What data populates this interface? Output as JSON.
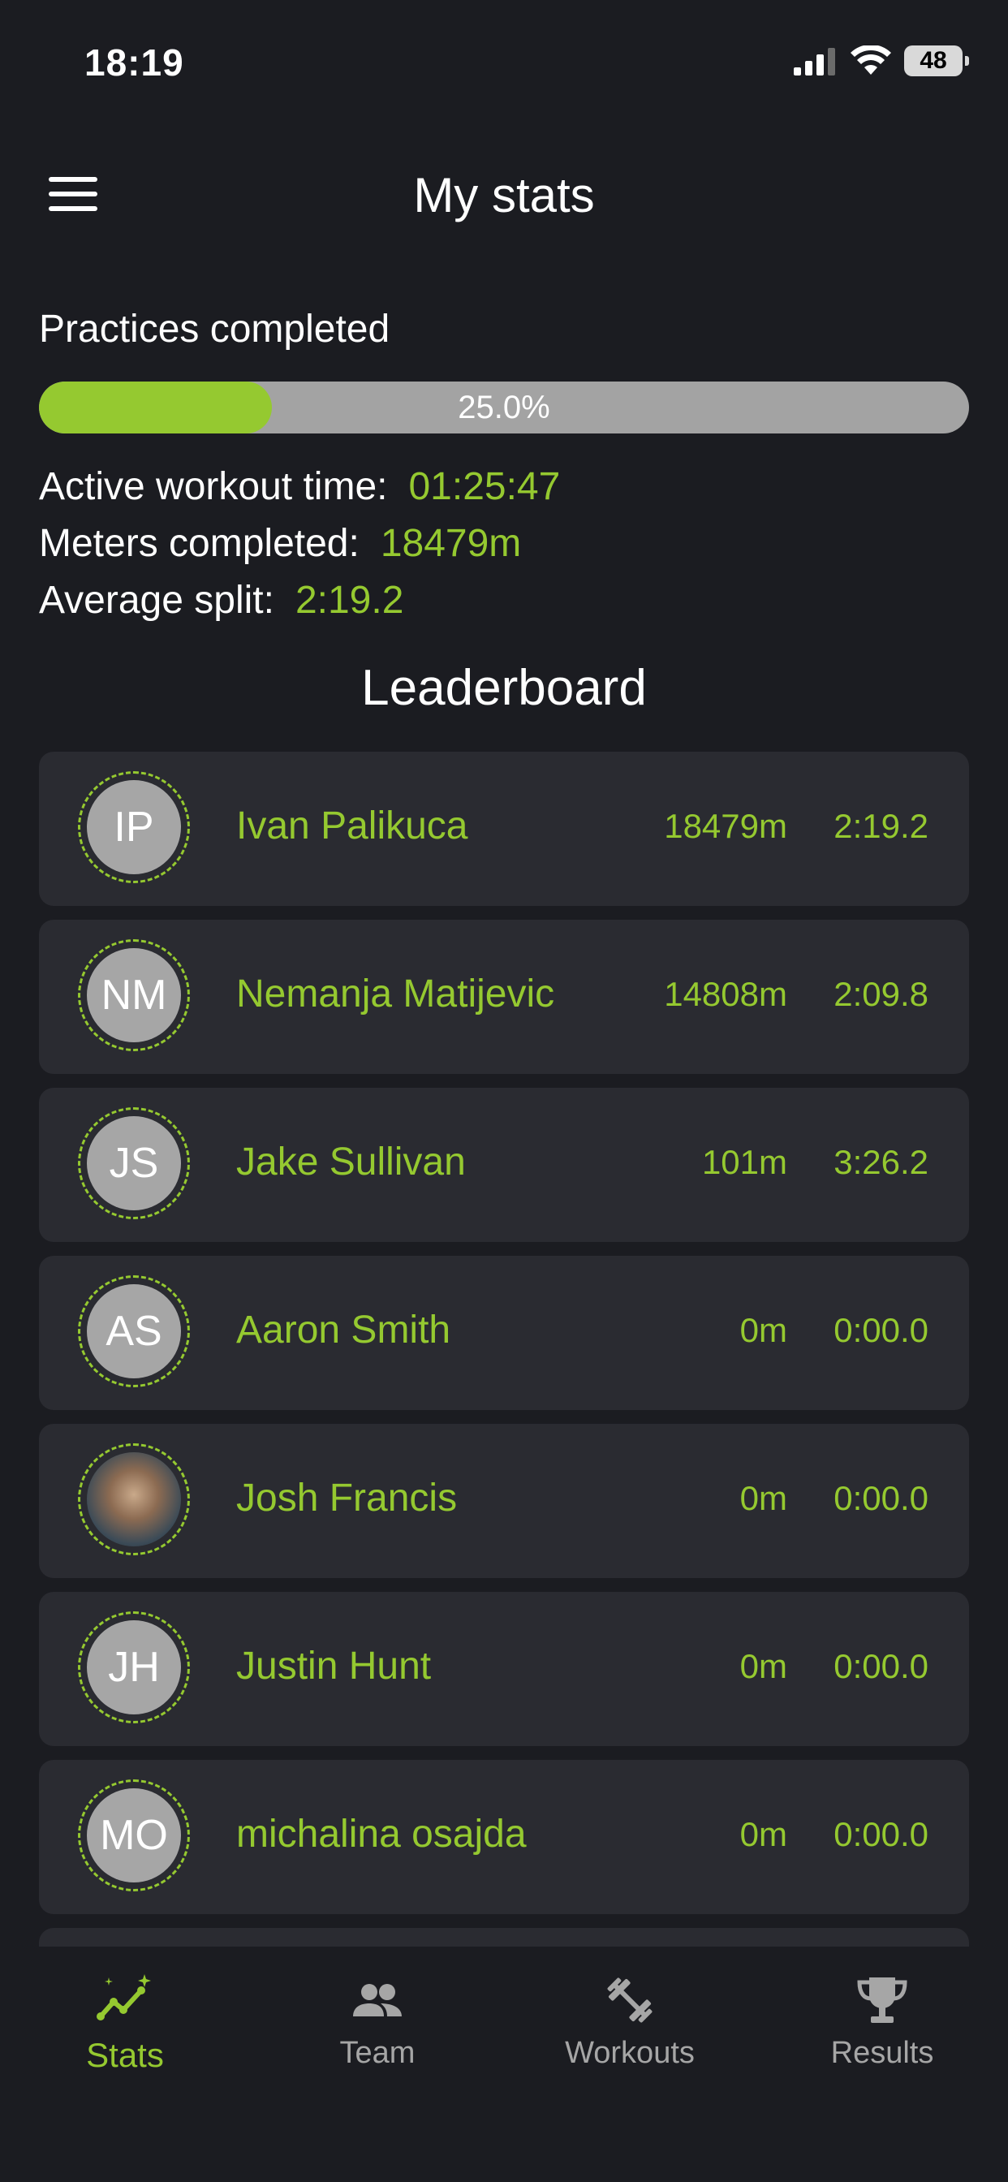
{
  "status_bar": {
    "time": "18:19",
    "battery": "48"
  },
  "header": {
    "title": "My stats"
  },
  "practices": {
    "label": "Practices completed",
    "percent_text": "25.0%",
    "fraction": 0.25
  },
  "stats": [
    {
      "label": "Active workout time:",
      "value": "01:25:47"
    },
    {
      "label": "Meters completed:",
      "value": "18479m"
    },
    {
      "label": "Average split:",
      "value": "2:19.2"
    }
  ],
  "leaderboard": {
    "title": "Leaderboard",
    "entries": [
      {
        "initials": "IP",
        "name": "Ivan Palikuca",
        "meters": "18479m",
        "split": "2:19.2"
      },
      {
        "initials": "NM",
        "name": "Nemanja Matijevic",
        "meters": "14808m",
        "split": "2:09.8"
      },
      {
        "initials": "JS",
        "name": "Jake Sullivan",
        "meters": "101m",
        "split": "3:26.2"
      },
      {
        "initials": "AS",
        "name": "Aaron Smith",
        "meters": "0m",
        "split": "0:00.0"
      },
      {
        "initials": "",
        "name": "Josh Francis",
        "meters": "0m",
        "split": "0:00.0"
      },
      {
        "initials": "JH",
        "name": "Justin Hunt",
        "meters": "0m",
        "split": "0:00.0"
      },
      {
        "initials": "MO",
        "name": "michalina osajda",
        "meters": "0m",
        "split": "0:00.0"
      }
    ]
  },
  "tabs": [
    {
      "label": "Stats",
      "icon": "stats-icon",
      "active": true
    },
    {
      "label": "Team",
      "icon": "team-icon",
      "active": false
    },
    {
      "label": "Workouts",
      "icon": "workouts-icon",
      "active": false
    },
    {
      "label": "Results",
      "icon": "results-icon",
      "active": false
    }
  ],
  "colors": {
    "accent": "#95c930",
    "background": "#1b1c21",
    "card": "#2a2b31",
    "avatar": "#a6a6a6",
    "inactive": "#a6a6a6"
  }
}
